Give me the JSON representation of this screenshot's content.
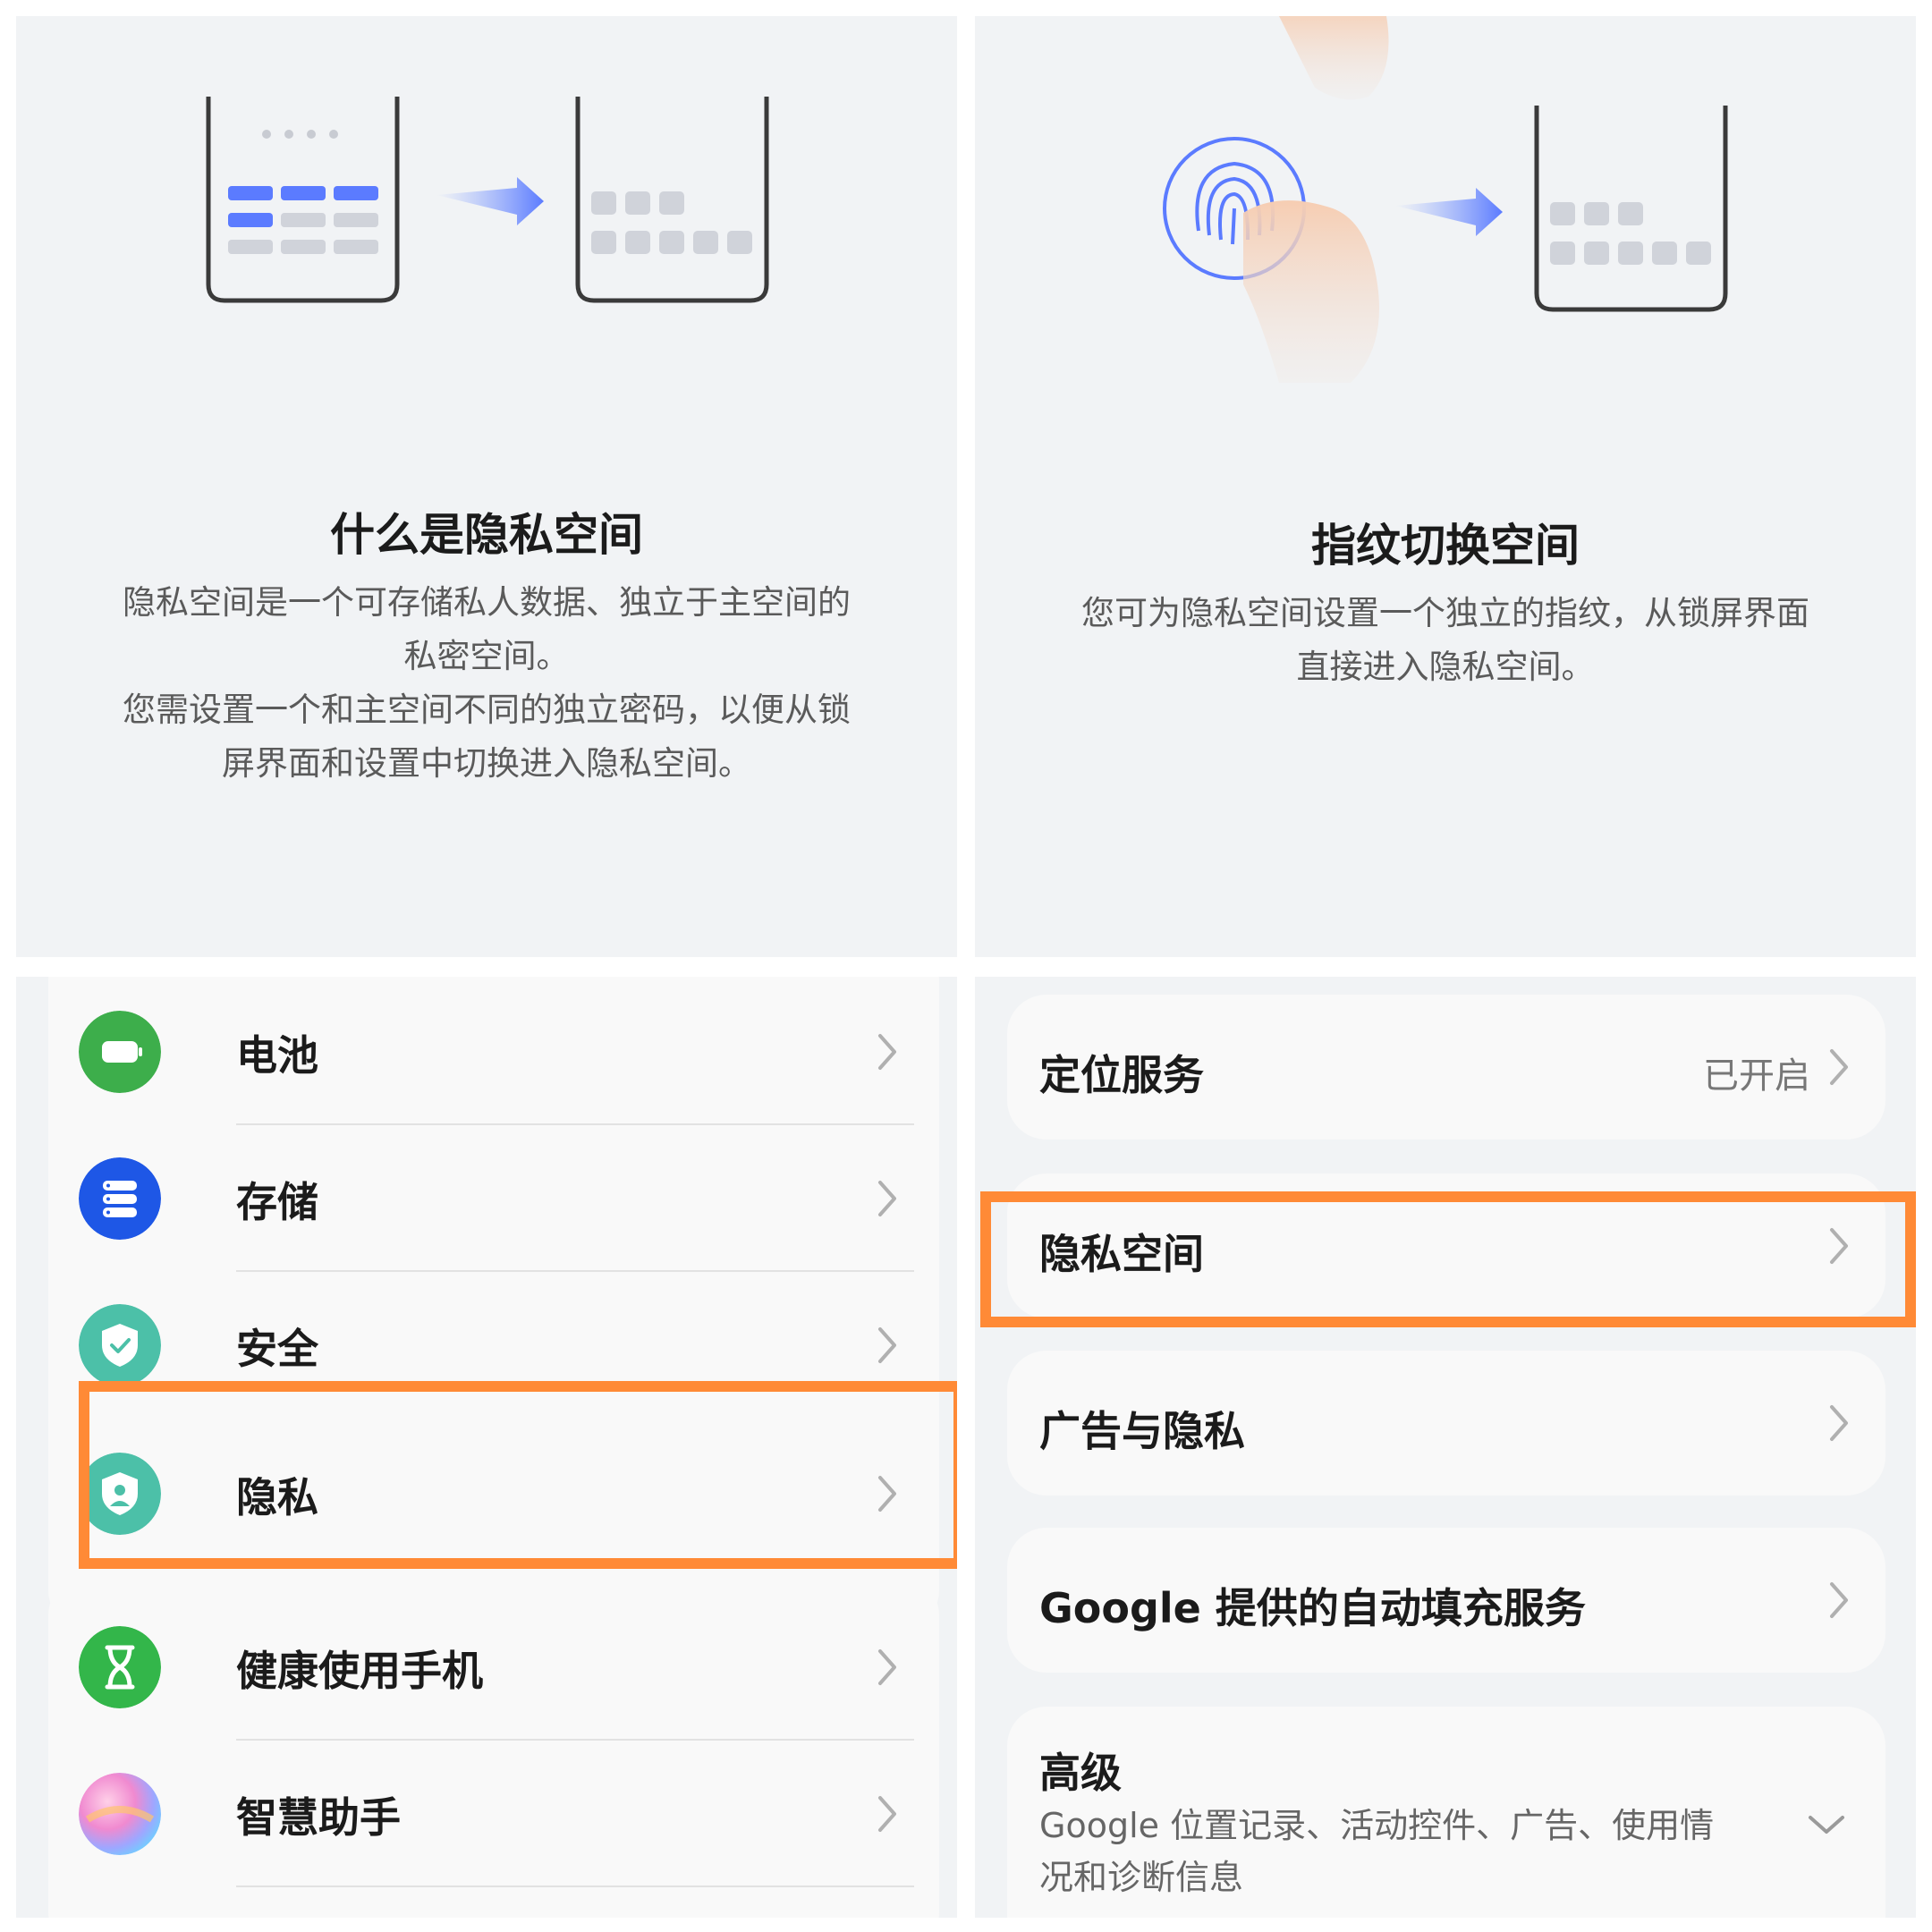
{
  "intro_private_space": {
    "title": "什么是隐私空间",
    "description_lines": [
      "隐私空间是一个可存储私人数据、独立于主空间的",
      "私密空间。",
      "您需设置一个和主空间不同的独立密码，以便从锁",
      "屏界面和设置中切换进入隐私空间。"
    ]
  },
  "intro_fingerprint": {
    "title": "指纹切换空间",
    "description_lines": [
      "您可为隐私空间设置一个独立的指纹，从锁屏界面",
      "直接进入隐私空间。"
    ]
  },
  "settings_list": {
    "items": [
      {
        "label": "电池",
        "icon": "battery-icon",
        "color": "#3dae4b"
      },
      {
        "label": "存储",
        "icon": "storage-icon",
        "color": "#1e57e6"
      },
      {
        "label": "安全",
        "icon": "security-shield-icon",
        "color": "#4cc0a8"
      },
      {
        "label": "隐私",
        "icon": "privacy-shield-icon",
        "color": "#4cc0a8"
      },
      {
        "label": "健康使用手机",
        "icon": "hourglass-icon",
        "color": "#33b64a"
      },
      {
        "label": "智慧助手",
        "icon": "assistant-orb-icon",
        "color": "#a78bfa"
      }
    ]
  },
  "privacy_page": {
    "location": {
      "label": "定位服务",
      "value": "已开启"
    },
    "private_space": {
      "label": "隐私空间"
    },
    "ads_privacy": {
      "label": "广告与隐私"
    },
    "google_autofill": {
      "label": "Google 提供的自动填充服务"
    },
    "advanced": {
      "label": "高级",
      "sub_lines": [
        "Google 位置记录、活动控件、广告、使用情",
        "况和诊断信息"
      ]
    }
  },
  "highlight_color": "#ff8a36"
}
